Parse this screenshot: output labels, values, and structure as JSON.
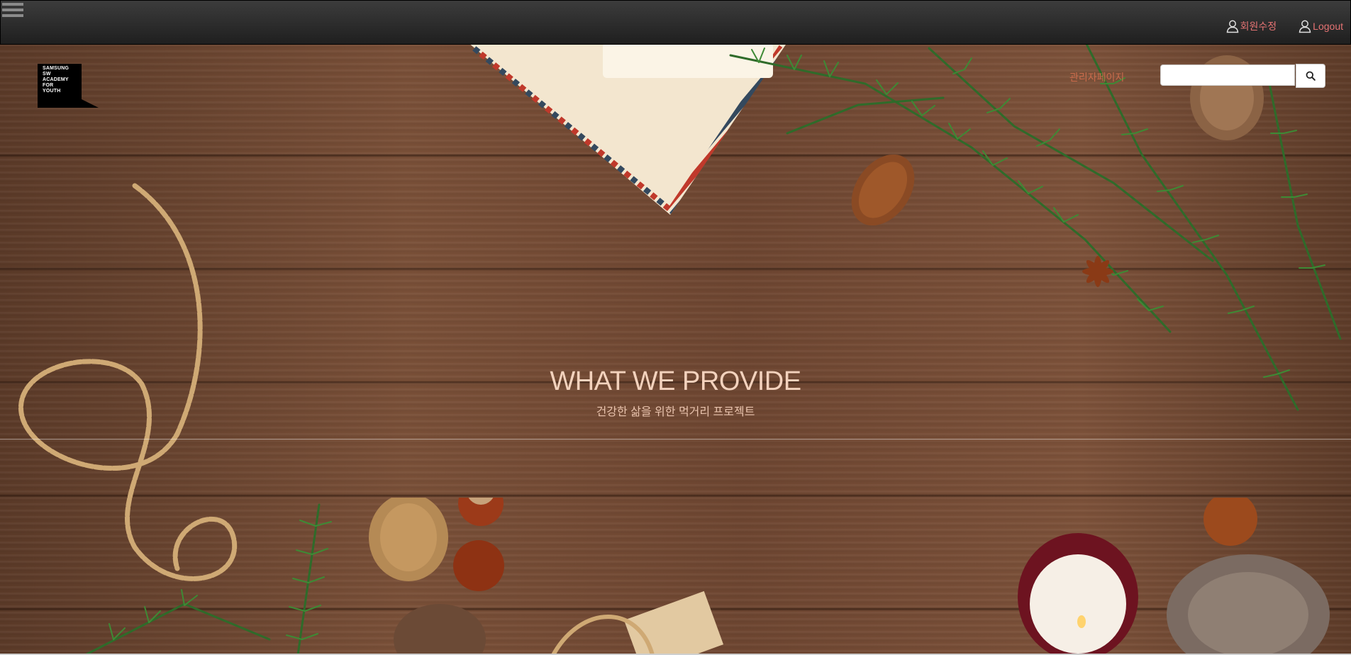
{
  "navbar": {
    "edit_profile_label": "회원수정",
    "logout_label": "Logout",
    "link_color": "#e57373",
    "user_icon": "user-icon",
    "menu_icon": "hamburger-icon"
  },
  "logo": {
    "text": "SAMSUNG\nSW\nACADEMY\nFOR\nYOUTH"
  },
  "header": {
    "tag_link": "관리자페이지"
  },
  "search": {
    "placeholder": "",
    "value": "",
    "button_icon": "search-icon"
  },
  "hero": {
    "title": "WHAT WE PROVIDE",
    "subtitle": "건강한 삶을 위한 먹거리 프로젝트"
  }
}
